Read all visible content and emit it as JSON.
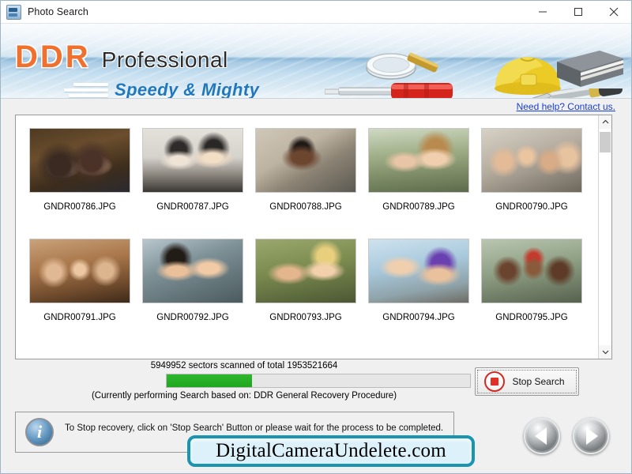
{
  "window": {
    "title": "Photo Search",
    "icon": "app-icon",
    "controls": {
      "minimize": "minimize-icon",
      "maximize": "maximize-icon",
      "close": "close-icon"
    }
  },
  "banner": {
    "brand": "DDR",
    "product": "Professional",
    "tagline": "Speedy & Mighty",
    "artwork": [
      "magnifier-icon",
      "screwdriver-icon",
      "hardhat-icon",
      "book-icon",
      "pen-icon"
    ],
    "colors": {
      "brand_orange": "#f07030",
      "tagline_blue": "#1f78bd"
    }
  },
  "help": {
    "link_text": "Need help? Contact us."
  },
  "results": {
    "rows": [
      [
        {
          "label": "GNDR00786.JPG",
          "thumb": "p1"
        },
        {
          "label": "GNDR00787.JPG",
          "thumb": "p2"
        },
        {
          "label": "GNDR00788.JPG",
          "thumb": "p3"
        },
        {
          "label": "GNDR00789.JPG",
          "thumb": "p4"
        },
        {
          "label": "GNDR00790.JPG",
          "thumb": "p5"
        }
      ],
      [
        {
          "label": "GNDR00791.JPG",
          "thumb": "p6"
        },
        {
          "label": "GNDR00792.JPG",
          "thumb": "p7"
        },
        {
          "label": "GNDR00793.JPG",
          "thumb": "p8"
        },
        {
          "label": "GNDR00794.JPG",
          "thumb": "p9"
        },
        {
          "label": "GNDR00795.JPG",
          "thumb": "p10"
        }
      ]
    ],
    "scrollbar": {
      "up_arrow": "chevron-up-icon",
      "down_arrow": "chevron-down-icon"
    }
  },
  "progress": {
    "sectors_text": "5949952 sectors scanned of total 1953521664",
    "sectors_scanned": 5949952,
    "sectors_total": 1953521664,
    "percent": 28,
    "bar_color": "#2eb82e",
    "basis_text": "(Currently performing Search based on:  DDR General Recovery Procedure)",
    "stop_button_label": "Stop Search",
    "stop_button_icon": "stop-icon"
  },
  "info": {
    "icon": "info-icon",
    "message": "To Stop recovery, click on 'Stop Search' Button or please wait for the process to be completed."
  },
  "footer": {
    "website": "DigitalCameraUndelete.com",
    "badge_border_color": "#1a94b0",
    "prev_button": "previous-arrow-icon",
    "next_button": "next-arrow-icon"
  }
}
